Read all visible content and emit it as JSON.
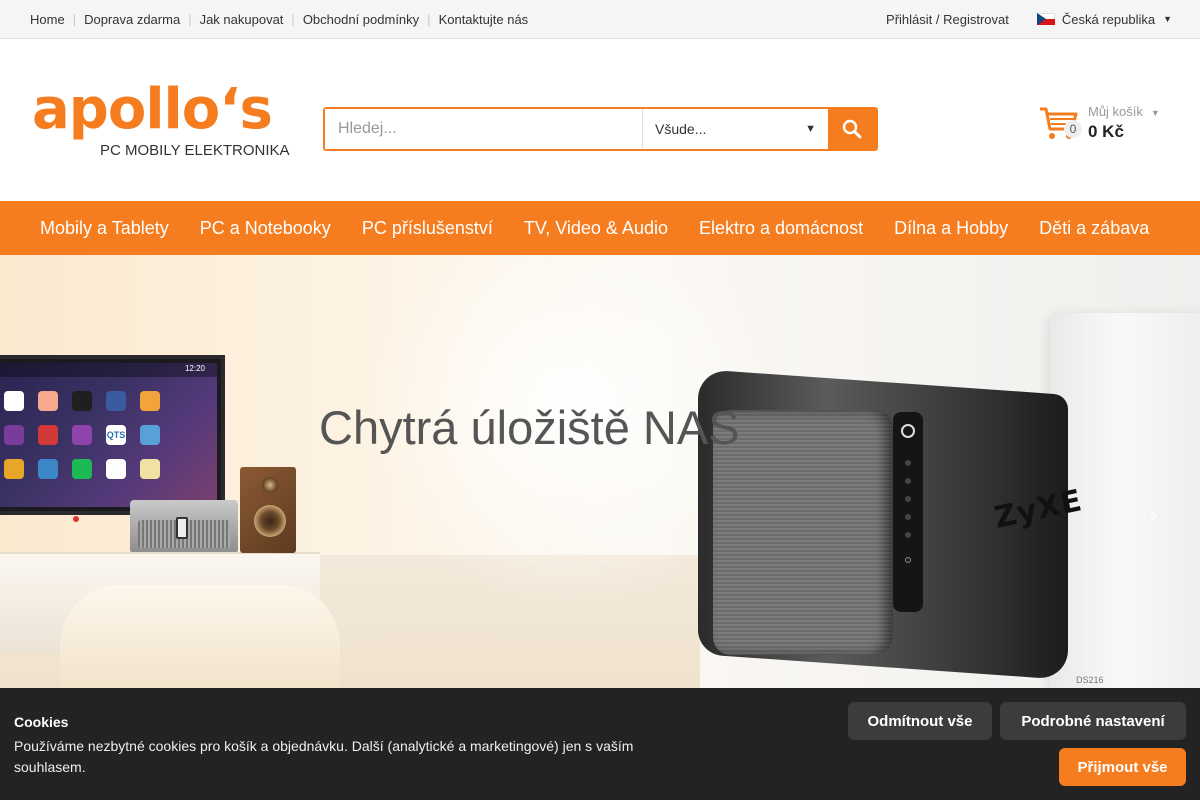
{
  "topbar": {
    "links": [
      "Home",
      "Doprava zdarma",
      "Jak nakupovat",
      "Obchodní podmínky",
      "Kontaktujte nás"
    ],
    "login": "Přihlásit / Registrovat",
    "country": "Česká republika"
  },
  "logo": {
    "word": "apollo‘s",
    "subtitle": "PC MOBILY ELEKTRONIKA"
  },
  "search": {
    "placeholder": "Hledej...",
    "scope": "Všude..."
  },
  "cart": {
    "label": "Můj košík",
    "count": "0",
    "total": "0 Kč"
  },
  "nav": {
    "items": [
      "Mobily a Tablety",
      "PC a Notebooky",
      "PC příslušenství",
      "TV, Video & Audio",
      "Elektro a domácnost",
      "Dílna a Hobby",
      "Děti a zábava"
    ]
  },
  "banner": {
    "title": "Chytrá úložiště NAS",
    "nas_brand": "ZyXE",
    "nas2_label": "DS216",
    "tv_time": "12:20",
    "tv_qts": "QTS"
  },
  "cookies": {
    "title": "Cookies",
    "text": "Používáme nezbytné cookies pro košík a objednávku. Další (analytické a marketingové) jen s vaším souhlasem.",
    "reject": "Odmítnout vše",
    "settings": "Podrobné nastavení",
    "accept": "Přijmout vše"
  },
  "colors": {
    "accent": "#f57c1f",
    "cookie_bg": "#232323"
  }
}
